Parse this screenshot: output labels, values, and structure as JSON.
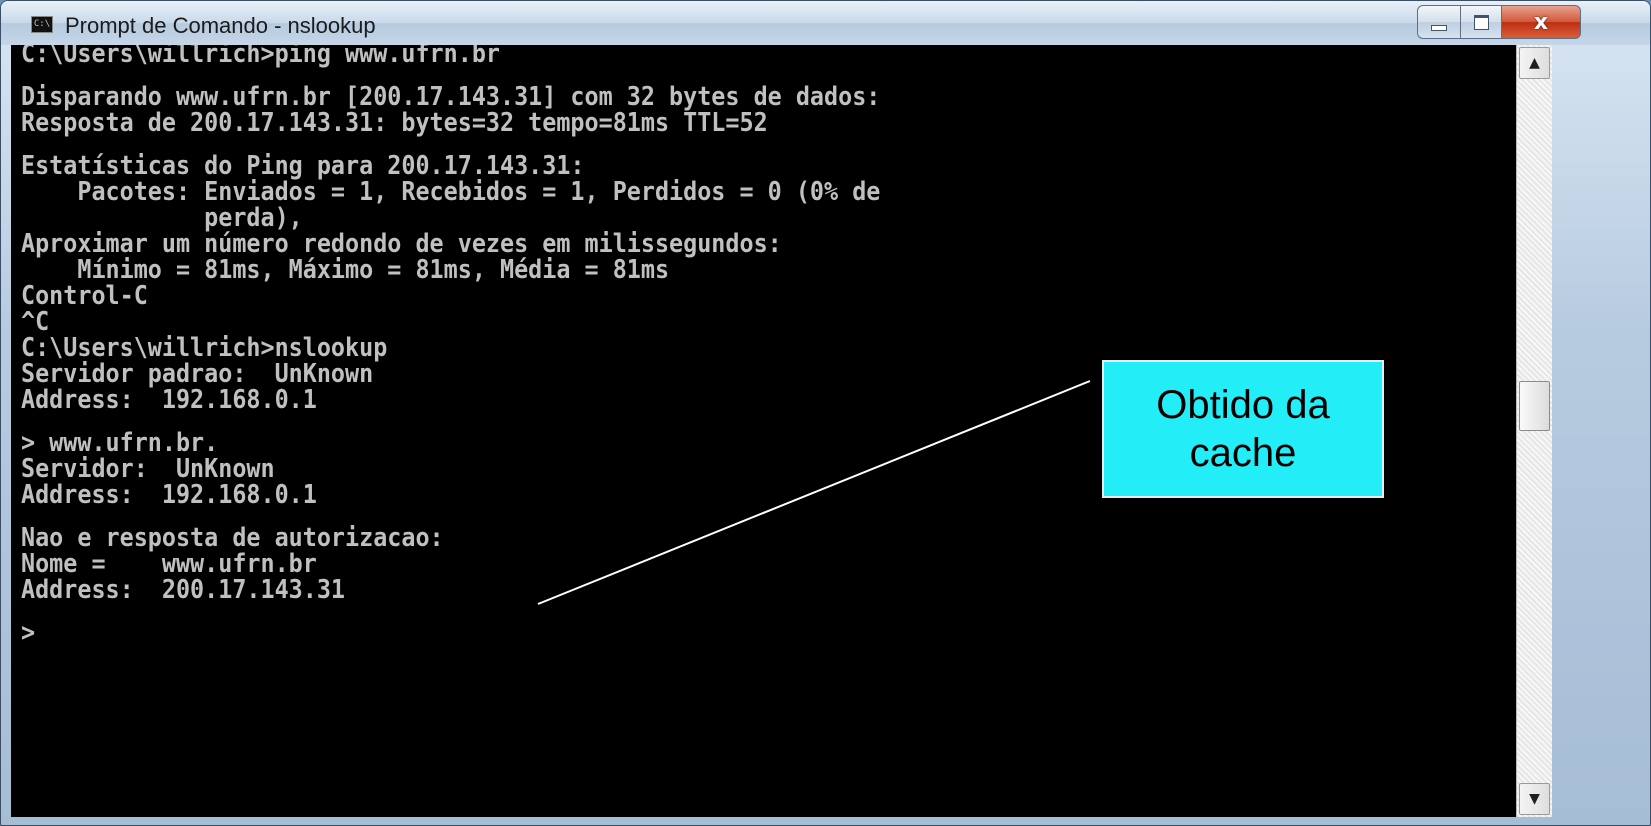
{
  "window": {
    "title": "Prompt de Comando - nslookup",
    "icon": "cmd-icon",
    "controls": {
      "minimize": "minimize-icon",
      "maximize": "maximize-icon",
      "close": "x"
    }
  },
  "console": {
    "lines": [
      "C:\\Users\\willrich>ping www.ufrn.br",
      "",
      "Disparando www.ufrn.br [200.17.143.31] com 32 bytes de dados:",
      "Resposta de 200.17.143.31: bytes=32 tempo=81ms TTL=52",
      "",
      "Estatísticas do Ping para 200.17.143.31:",
      "    Pacotes: Enviados = 1, Recebidos = 1, Perdidos = 0 (0% de",
      "             perda),",
      "Aproximar um número redondo de vezes em milissegundos:",
      "    Mínimo = 81ms, Máximo = 81ms, Média = 81ms",
      "Control-C",
      "^C",
      "C:\\Users\\willrich>nslookup",
      "Servidor padrao:  UnKnown",
      "Address:  192.168.0.1",
      "",
      "> www.ufrn.br.",
      "Servidor:  UnKnown",
      "Address:  192.168.0.1",
      "",
      "Nao e resposta de autorizacao:",
      "Nome =    www.ufrn.br",
      "Address:  200.17.143.31",
      "",
      ">"
    ]
  },
  "scrollbar": {
    "up_icon": "▲",
    "down_icon": "▼"
  },
  "annotation": {
    "text": "Obtido da\ncache",
    "background": "#23eef7"
  },
  "colors": {
    "console_bg": "#000000",
    "console_fg": "#c0c0c0"
  }
}
